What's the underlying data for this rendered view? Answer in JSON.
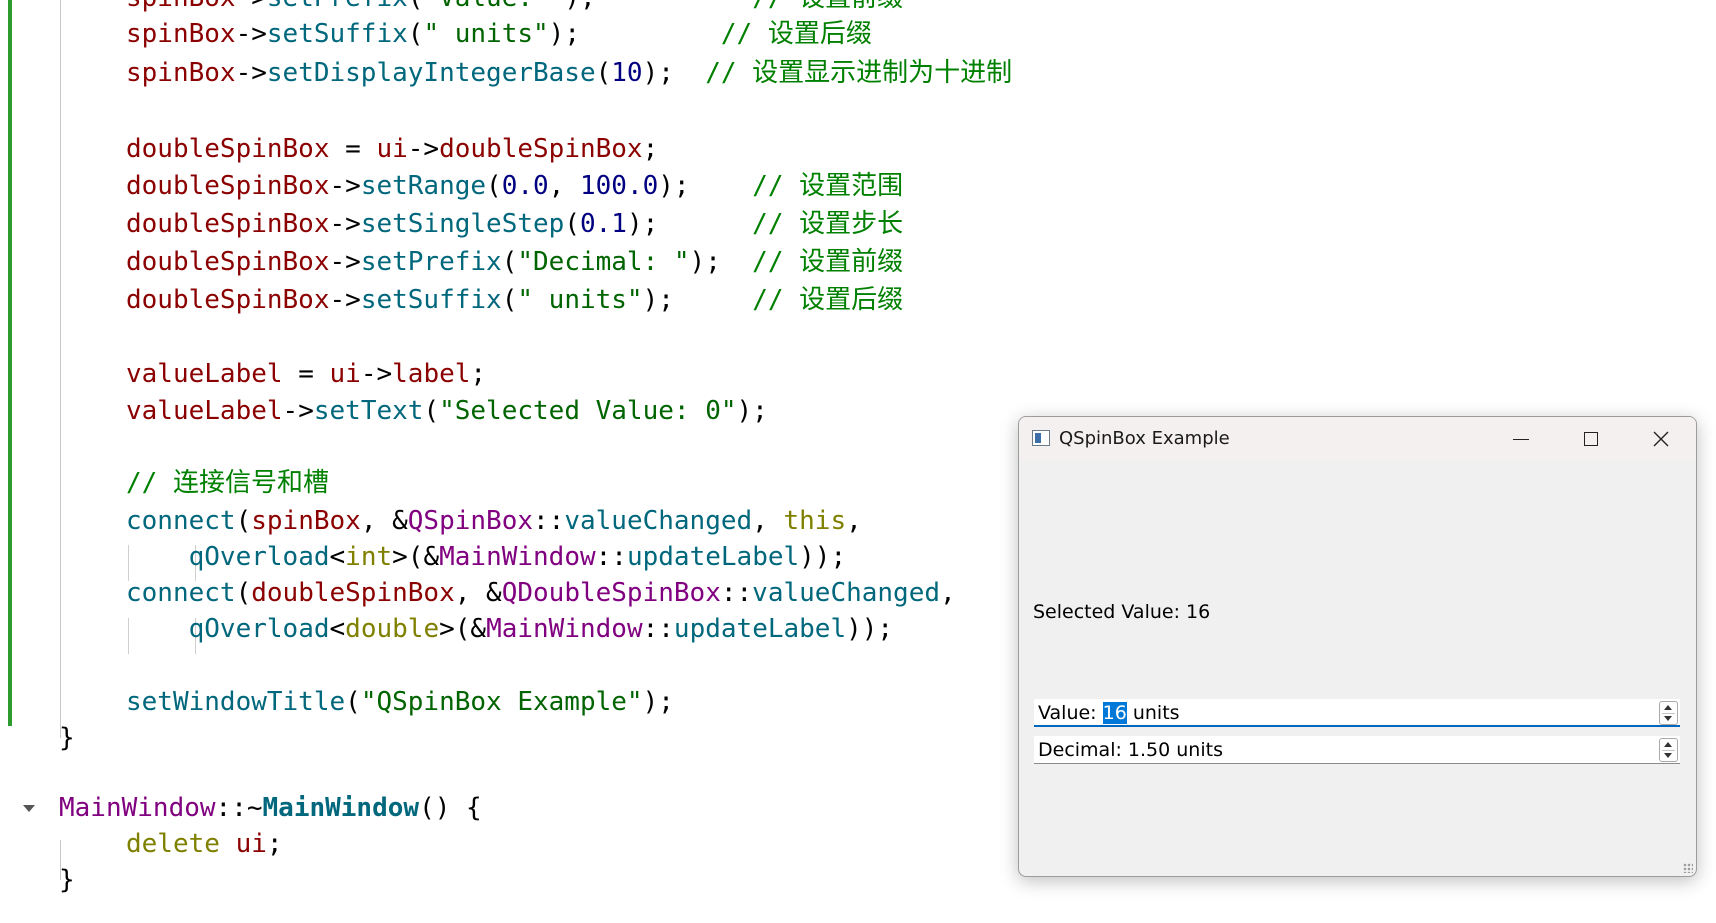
{
  "editor": {
    "lines": [
      {
        "tokens": [
          {
            "t": "spinBox",
            "c": "var"
          },
          {
            "t": "->"
          },
          {
            "t": "setPrefix",
            "c": "fn"
          },
          {
            "t": "("
          },
          {
            "t": "\"Value: \"",
            "c": "str"
          },
          {
            "t": ");"
          },
          {
            "t": "          "
          },
          {
            "t": "// 设置前缀",
            "c": "cm"
          }
        ]
      },
      {
        "tokens": [
          {
            "t": "spinBox",
            "c": "var"
          },
          {
            "t": "->"
          },
          {
            "t": "setSuffix",
            "c": "fn"
          },
          {
            "t": "("
          },
          {
            "t": "\" units\"",
            "c": "str"
          },
          {
            "t": ");"
          },
          {
            "t": "         "
          },
          {
            "t": "// 设置后缀",
            "c": "cm"
          }
        ]
      },
      {
        "tokens": [
          {
            "t": "spinBox",
            "c": "var"
          },
          {
            "t": "->"
          },
          {
            "t": "setDisplayIntegerBase",
            "c": "fn"
          },
          {
            "t": "("
          },
          {
            "t": "10",
            "c": "num"
          },
          {
            "t": ");"
          },
          {
            "t": "  "
          },
          {
            "t": "// 设置显示进制为十进制",
            "c": "cm"
          }
        ]
      },
      {
        "tokens": []
      },
      {
        "tokens": [
          {
            "t": "doubleSpinBox",
            "c": "var"
          },
          {
            "t": " = "
          },
          {
            "t": "ui",
            "c": "var"
          },
          {
            "t": "->"
          },
          {
            "t": "doubleSpinBox",
            "c": "var"
          },
          {
            "t": ";"
          }
        ]
      },
      {
        "tokens": [
          {
            "t": "doubleSpinBox",
            "c": "var"
          },
          {
            "t": "->"
          },
          {
            "t": "setRange",
            "c": "fn"
          },
          {
            "t": "("
          },
          {
            "t": "0.0",
            "c": "num"
          },
          {
            "t": ", "
          },
          {
            "t": "100.0",
            "c": "num"
          },
          {
            "t": ");"
          },
          {
            "t": "    "
          },
          {
            "t": "// 设置范围",
            "c": "cm"
          }
        ]
      },
      {
        "tokens": [
          {
            "t": "doubleSpinBox",
            "c": "var"
          },
          {
            "t": "->"
          },
          {
            "t": "setSingleStep",
            "c": "fn"
          },
          {
            "t": "("
          },
          {
            "t": "0.1",
            "c": "num"
          },
          {
            "t": ");"
          },
          {
            "t": "      "
          },
          {
            "t": "// 设置步长",
            "c": "cm"
          }
        ]
      },
      {
        "tokens": [
          {
            "t": "doubleSpinBox",
            "c": "var"
          },
          {
            "t": "->"
          },
          {
            "t": "setPrefix",
            "c": "fn"
          },
          {
            "t": "("
          },
          {
            "t": "\"Decimal: \"",
            "c": "str"
          },
          {
            "t": ");"
          },
          {
            "t": "  "
          },
          {
            "t": "// 设置前缀",
            "c": "cm"
          }
        ]
      },
      {
        "tokens": [
          {
            "t": "doubleSpinBox",
            "c": "var"
          },
          {
            "t": "->"
          },
          {
            "t": "setSuffix",
            "c": "fn"
          },
          {
            "t": "("
          },
          {
            "t": "\" units\"",
            "c": "str"
          },
          {
            "t": ");"
          },
          {
            "t": "     "
          },
          {
            "t": "// 设置后缀",
            "c": "cm"
          }
        ]
      },
      {
        "tokens": []
      },
      {
        "tokens": [
          {
            "t": "valueLabel",
            "c": "var"
          },
          {
            "t": " = "
          },
          {
            "t": "ui",
            "c": "var"
          },
          {
            "t": "->"
          },
          {
            "t": "label",
            "c": "var"
          },
          {
            "t": ";"
          }
        ]
      },
      {
        "tokens": [
          {
            "t": "valueLabel",
            "c": "var"
          },
          {
            "t": "->"
          },
          {
            "t": "setText",
            "c": "fn"
          },
          {
            "t": "("
          },
          {
            "t": "\"Selected Value: 0\"",
            "c": "str"
          },
          {
            "t": ");"
          }
        ]
      },
      {
        "tokens": []
      },
      {
        "tokens": [
          {
            "t": "// 连接信号和槽",
            "c": "cm"
          }
        ]
      },
      {
        "tokens": [
          {
            "t": "connect",
            "c": "fn"
          },
          {
            "t": "("
          },
          {
            "t": "spinBox",
            "c": "var"
          },
          {
            "t": ", &"
          },
          {
            "t": "QSpinBox",
            "c": "ty"
          },
          {
            "t": "::"
          },
          {
            "t": "valueChanged",
            "c": "fn"
          },
          {
            "t": ", "
          },
          {
            "t": "this",
            "c": "kw"
          },
          {
            "t": ","
          }
        ]
      },
      {
        "tokens": [
          {
            "t": "    "
          },
          {
            "t": "qOverload",
            "c": "fn"
          },
          {
            "t": "<"
          },
          {
            "t": "int",
            "c": "kw"
          },
          {
            "t": ">(&"
          },
          {
            "t": "MainWindow",
            "c": "ty"
          },
          {
            "t": "::"
          },
          {
            "t": "updateLabel",
            "c": "fn"
          },
          {
            "t": "));"
          }
        ]
      },
      {
        "tokens": [
          {
            "t": "connect",
            "c": "fn"
          },
          {
            "t": "("
          },
          {
            "t": "doubleSpinBox",
            "c": "var"
          },
          {
            "t": ", &"
          },
          {
            "t": "QDoubleSpinBox",
            "c": "ty"
          },
          {
            "t": "::"
          },
          {
            "t": "valueChanged",
            "c": "fn"
          },
          {
            "t": ","
          }
        ]
      },
      {
        "tokens": [
          {
            "t": "    "
          },
          {
            "t": "qOverload",
            "c": "fn"
          },
          {
            "t": "<"
          },
          {
            "t": "double",
            "c": "kw"
          },
          {
            "t": ">(&"
          },
          {
            "t": "MainWindow",
            "c": "ty"
          },
          {
            "t": "::"
          },
          {
            "t": "updateLabel",
            "c": "fn"
          },
          {
            "t": "));"
          }
        ]
      },
      {
        "tokens": []
      },
      {
        "tokens": [
          {
            "t": "setWindowTitle",
            "c": "fn"
          },
          {
            "t": "("
          },
          {
            "t": "\"QSpinBox Example\"",
            "c": "str"
          },
          {
            "t": ");"
          }
        ]
      },
      {
        "tokens": [
          {
            "t": "}"
          }
        ]
      },
      {
        "tokens": []
      },
      {
        "tokens": [
          {
            "t": "MainWindow",
            "c": "ty"
          },
          {
            "t": "::~"
          },
          {
            "t": "MainWindow",
            "c": "fn-b"
          },
          {
            "t": "() {"
          }
        ]
      },
      {
        "tokens": [
          {
            "t": "delete",
            "c": "kw"
          },
          {
            "t": " "
          },
          {
            "t": "ui",
            "c": "var"
          },
          {
            "t": ";"
          }
        ]
      },
      {
        "tokens": [
          {
            "t": "}"
          }
        ]
      }
    ]
  },
  "window": {
    "title": "QSpinBox Example",
    "minimize_icon": "minimize-icon",
    "maximize_icon": "maximize-icon",
    "close_icon": "close-icon",
    "selected_label": "Selected Value: 16",
    "spin": {
      "prefix": "Value: ",
      "value": "16",
      "suffix": " units"
    },
    "double_spin": {
      "text": "Decimal: 1.50 units"
    }
  }
}
